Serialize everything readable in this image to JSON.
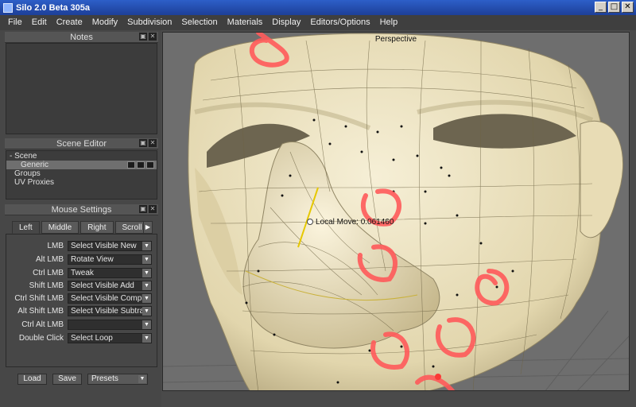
{
  "window": {
    "title": "Silo 2.0 Beta 305a",
    "buttons": [
      "_",
      "□",
      "✕"
    ]
  },
  "menubar": [
    "File",
    "Edit",
    "Create",
    "Modify",
    "Subdivision",
    "Selection",
    "Materials",
    "Display",
    "Editors/Options",
    "Help"
  ],
  "notes": {
    "header": "Notes"
  },
  "scene_editor": {
    "header": "Scene Editor",
    "rows": [
      {
        "label": "- Scene"
      },
      {
        "label": "Generic"
      },
      {
        "label": "Groups"
      },
      {
        "label": "UV Proxies"
      }
    ]
  },
  "mouse_settings": {
    "header": "Mouse Settings",
    "tabs": [
      "Left",
      "Middle",
      "Right",
      "Scroll"
    ],
    "rows": [
      {
        "label": "LMB",
        "value": "Select Visible New"
      },
      {
        "label": "Alt LMB",
        "value": "Rotate View"
      },
      {
        "label": "Ctrl LMB",
        "value": "Tweak"
      },
      {
        "label": "Shift LMB",
        "value": "Select Visible Add"
      },
      {
        "label": "Ctrl Shift LMB",
        "value": "Select Visible Complem"
      },
      {
        "label": "Alt Shift LMB",
        "value": "Select Visible Subtract"
      },
      {
        "label": "Ctrl Alt LMB",
        "value": ""
      },
      {
        "label": "Double Click",
        "value": "Select Loop"
      }
    ]
  },
  "footer": {
    "load": "Load",
    "save": "Save",
    "presets": "Presets"
  },
  "viewport": {
    "label": "Perspective",
    "readout": "Local Move: 0.061460"
  },
  "colors": {
    "title_bar": "#1d3f98",
    "panel": "#474747",
    "mesh": "#efe7c9",
    "annotation": "#ff5a5a",
    "selection": "#e6c800"
  }
}
